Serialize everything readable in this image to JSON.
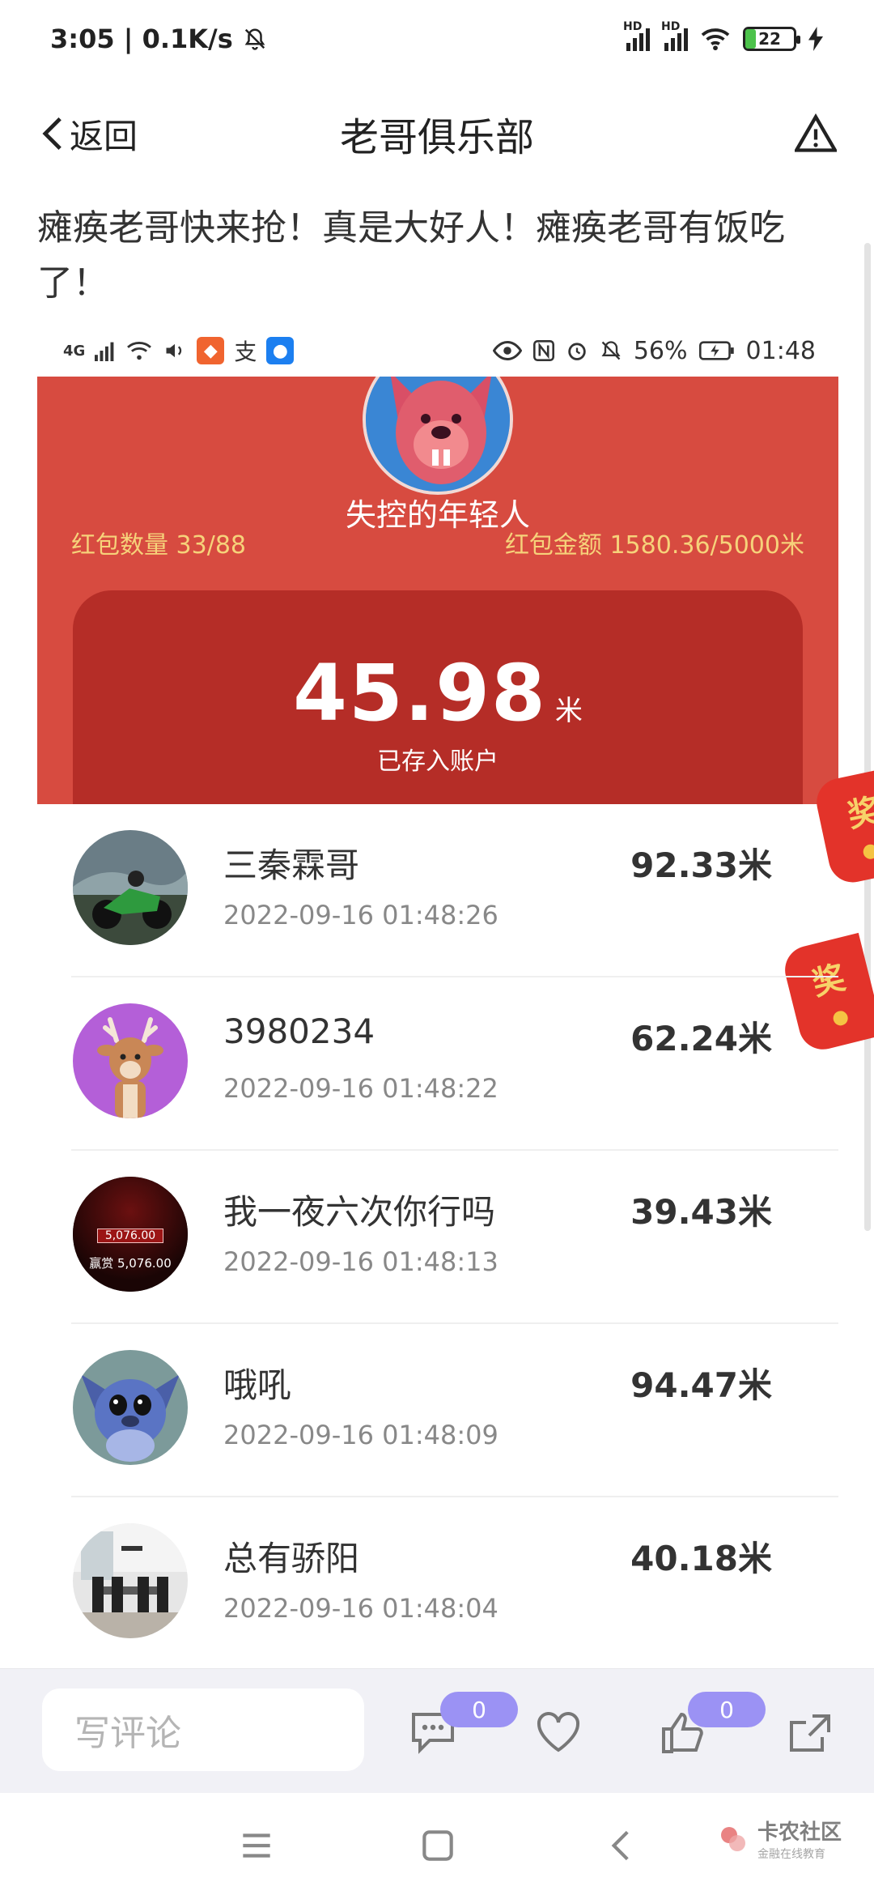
{
  "status_bar": {
    "time_speed": "3:05 | 0.1K/s",
    "network_label_1": "HD",
    "network_label_2": "HD",
    "battery": "22",
    "battery_level": 0.22
  },
  "nav": {
    "back_label": "返回",
    "title": "老哥俱乐部"
  },
  "post": {
    "text": "瘫痪老哥快来抢！真是大好人！瘫痪老哥有饭吃了！"
  },
  "embedded": {
    "status": {
      "network": "4G",
      "battery": "56%",
      "time": "01:48"
    },
    "sender_name": "失控的年轻人",
    "count_text": "红包数量 33/88",
    "amount_text": "红包金额 1580.36/5000米",
    "received_amount": "45.98",
    "received_unit": "米",
    "saved_text": "已存入账户",
    "envelope_char": "奖"
  },
  "records": [
    {
      "name": "三秦霖哥",
      "time": "2022-09-16 01:48:26",
      "amount": "92.33米",
      "avatar": "motorcycle"
    },
    {
      "name": "3980234",
      "time": "2022-09-16 01:48:22",
      "amount": "62.24米",
      "avatar": "deer"
    },
    {
      "name": "我一夜六次你行吗",
      "time": "2022-09-16 01:48:13",
      "amount": "39.43米",
      "avatar": "slot",
      "avatar_text": "赢赏 5,076.00",
      "avatar_text_2": "5,076.00"
    },
    {
      "name": "哦吼",
      "time": "2022-09-16 01:48:09",
      "amount": "94.47米",
      "avatar": "stitch"
    },
    {
      "name": "总有骄阳",
      "time": "2022-09-16 01:48:04",
      "amount": "40.18米",
      "avatar": "room"
    }
  ],
  "comment_bar": {
    "placeholder": "写评论",
    "comment_count": "0",
    "like_count": "0"
  },
  "watermark": {
    "title": "卡农社区",
    "subtitle": "金融在线教育"
  },
  "colors": {
    "red_panel": "#d74b40",
    "red_card": "#b52d27",
    "gold_text": "#f6d27a",
    "badge": "#9b92f4"
  }
}
